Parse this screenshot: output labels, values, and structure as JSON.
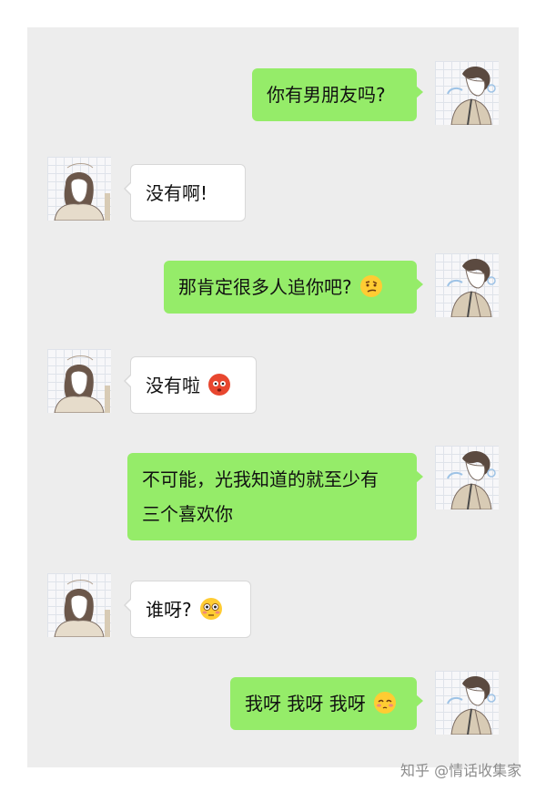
{
  "messages": [
    {
      "side": "right",
      "text": "你有男朋友吗?",
      "emoji": ""
    },
    {
      "side": "left",
      "text": "没有啊!",
      "emoji": ""
    },
    {
      "side": "right",
      "text": "那肯定很多人追你吧?",
      "emoji": "thinking-face-emoji"
    },
    {
      "side": "left",
      "text": "没有啦",
      "emoji": "embarrassed-face-emoji"
    },
    {
      "side": "right",
      "text_lines": [
        "不可能，光我知道的就至少有",
        "三个喜欢你"
      ],
      "emoji": ""
    },
    {
      "side": "left",
      "text": "谁呀?",
      "emoji": "flushed-face-emoji"
    },
    {
      "side": "right",
      "text": "我呀 我呀 我呀",
      "emoji": "shy-face-emoji"
    }
  ],
  "watermark": "知乎 @情话收集家",
  "colors": {
    "sent_bubble": "#95ec69",
    "received_bubble": "#ffffff",
    "chat_background": "#ededed",
    "watermark_text": "#8c8c8c"
  }
}
